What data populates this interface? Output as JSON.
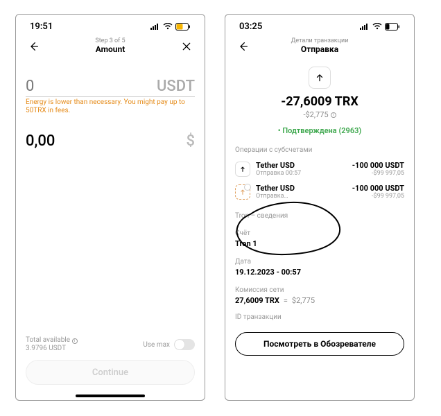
{
  "left": {
    "status": {
      "time": "19:51"
    },
    "nav": {
      "step": "Step 3 of 5",
      "title": "Amount"
    },
    "amount": {
      "value": "0",
      "currency": "USDT"
    },
    "warning": "Energy is lower than necessary. You might pay up to 50TRX in fees.",
    "fiat": {
      "value": "0,00",
      "currency": "$"
    },
    "available": {
      "label": "Total available",
      "value": "3.9796 USDT"
    },
    "usemax_label": "Use max",
    "continue_label": "Continue"
  },
  "right": {
    "status": {
      "time": "03:25"
    },
    "nav": {
      "step": "Детали транзакции",
      "title": "Отправка"
    },
    "amount_main": "-27,6009 TRX",
    "amount_usd": "-$2,775",
    "confirm": "Подтверждена (2963)",
    "subops_label": "Операции с субсчетами",
    "ops": [
      {
        "title": "Tether USD",
        "subtitle": "Отправка 00:57",
        "r1": "-100 000 USDT",
        "r2": "-$99 997,05"
      },
      {
        "title": "Tether USD",
        "subtitle": "Отправка…",
        "r1": "-100 000 USDT",
        "r2": "-$99 997,05"
      }
    ],
    "tron_section": "Tron – сведения",
    "account_label": "Счёт",
    "account_value": "Tron 1",
    "date_label": "Дата",
    "date_value": "19.12.2023 - 00:57",
    "fee_label": "Комиссия сети",
    "fee_trx": "27,6009 TRX",
    "fee_eq": "=",
    "fee_usd": "$2,775",
    "txid_label": "ID транзакции",
    "explorer_label": "Посмотреть в Обозревателе"
  }
}
